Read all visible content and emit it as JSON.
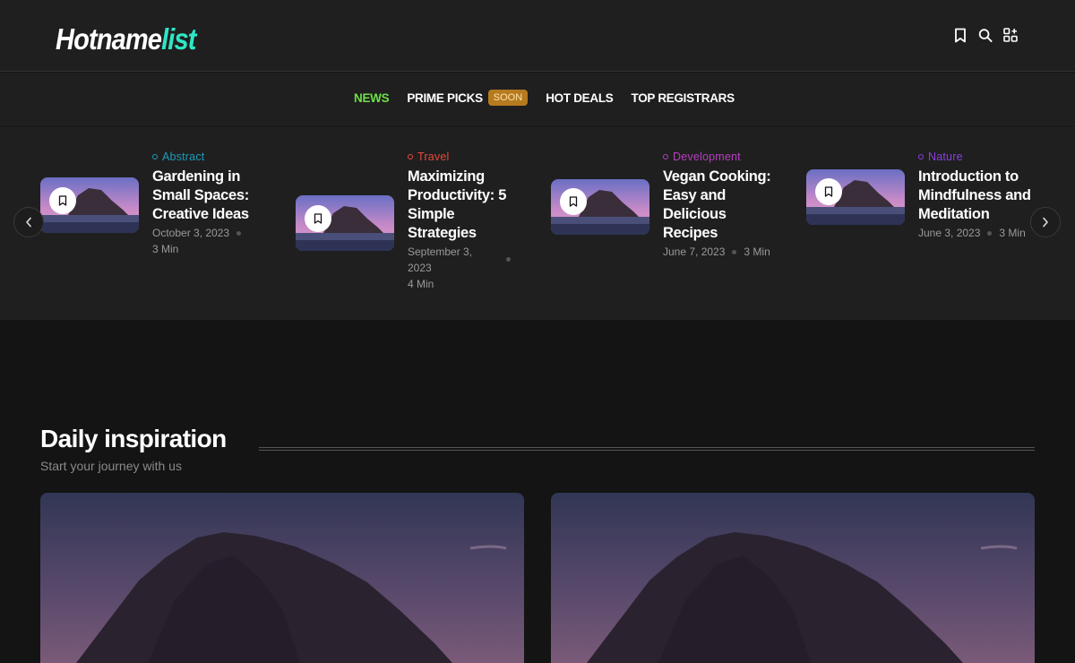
{
  "header": {
    "logo_part1": "Hotname",
    "logo_part2": "list",
    "icons": [
      "bookmark-icon",
      "search-icon",
      "apps-icon"
    ]
  },
  "nav": {
    "items": [
      {
        "label": "NEWS",
        "active": true
      },
      {
        "label": "PRIME PICKS",
        "badge": "SOON"
      },
      {
        "label": "HOT DEALS"
      },
      {
        "label": "TOP REGISTRARS"
      }
    ]
  },
  "carousel": {
    "cards": [
      {
        "category": "Abstract",
        "category_color": "#1e9bb8",
        "title": "Gardening in Small Spaces: Creative Ideas",
        "date": "October 3, 2023",
        "read_time": "3 Min"
      },
      {
        "category": "Travel",
        "category_color": "#e8483a",
        "title": "Maximizing Productivity: 5 Simple Strategies",
        "date": "September 3, 2023",
        "read_time": "4 Min"
      },
      {
        "category": "Development",
        "category_color": "#b83ec0",
        "title": "Vegan Cooking: Easy and Delicious Recipes",
        "date": "June 7, 2023",
        "read_time": "3 Min"
      },
      {
        "category": "Nature",
        "category_color": "#8a3fe0",
        "title": "Introduction to Mindfulness and Meditation",
        "date": "June 3, 2023",
        "read_time": "3 Min"
      }
    ]
  },
  "section": {
    "title": "Daily inspiration",
    "subtitle": "Start your journey with us"
  },
  "colors": {
    "accent_logo": "#2fe6c6",
    "nav_active": "#6ddf47",
    "badge_bg": "#b67a1f"
  }
}
